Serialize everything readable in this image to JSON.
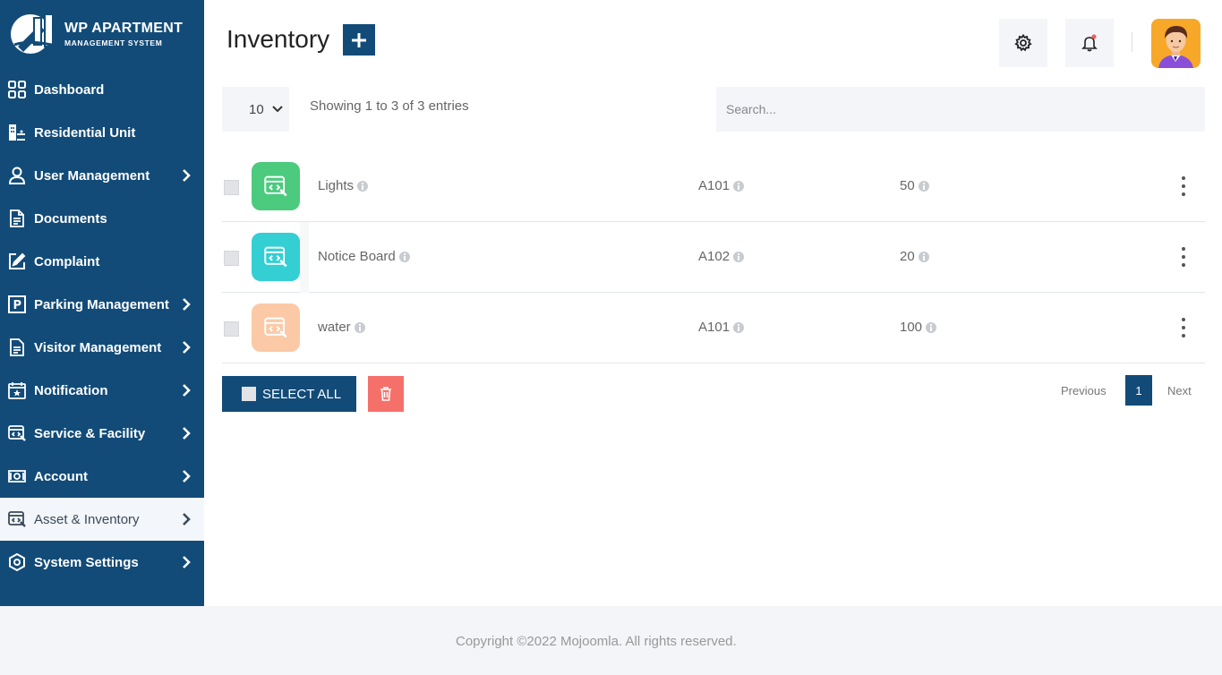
{
  "brand": {
    "title": "WP APARTMENT",
    "subtitle": "MANAGEMENT SYSTEM"
  },
  "sidebar": {
    "items": [
      {
        "label": "Dashboard",
        "icon": "dashboard-grid-icon",
        "has_arrow": false
      },
      {
        "label": "Residential Unit",
        "icon": "building-icon",
        "has_arrow": false
      },
      {
        "label": "User Management",
        "icon": "user-icon",
        "has_arrow": true
      },
      {
        "label": "Documents",
        "icon": "document-icon",
        "has_arrow": false
      },
      {
        "label": "Complaint",
        "icon": "edit-icon",
        "has_arrow": false
      },
      {
        "label": "Parking Management",
        "icon": "parking-icon",
        "has_arrow": true
      },
      {
        "label": "Visitor Management",
        "icon": "visitor-document-icon",
        "has_arrow": true
      },
      {
        "label": "Notification",
        "icon": "calendar-star-icon",
        "has_arrow": true
      },
      {
        "label": "Service & Facility",
        "icon": "service-icon",
        "has_arrow": true
      },
      {
        "label": "Account",
        "icon": "money-icon",
        "has_arrow": true
      },
      {
        "label": "Asset & Inventory",
        "icon": "asset-icon",
        "has_arrow": true,
        "active": true
      },
      {
        "label": "System Settings",
        "icon": "settings-hex-icon",
        "has_arrow": true
      }
    ]
  },
  "header": {
    "title": "Inventory"
  },
  "table_controls": {
    "page_length": "10",
    "info": "Showing 1 to 3 of 3 entries",
    "search_placeholder": "Search..."
  },
  "rows": [
    {
      "name": "Lights",
      "unit": "A101",
      "quantity": "50",
      "color": "#4cca7e"
    },
    {
      "name": "Notice Board",
      "unit": "A102",
      "quantity": "20",
      "color": "#33cfd3"
    },
    {
      "name": "water",
      "unit": "A101",
      "quantity": "100",
      "color": "#fbc9a6"
    }
  ],
  "actions": {
    "select_all": "SELECT ALL"
  },
  "pagination": {
    "previous": "Previous",
    "current": "1",
    "next": "Next"
  },
  "footer": {
    "text": "Copyright ©2022 Mojoomla. All rights reserved."
  },
  "colors": {
    "primary": "#124b78",
    "danger": "#f6706a",
    "panel": "#f3f5f9"
  }
}
